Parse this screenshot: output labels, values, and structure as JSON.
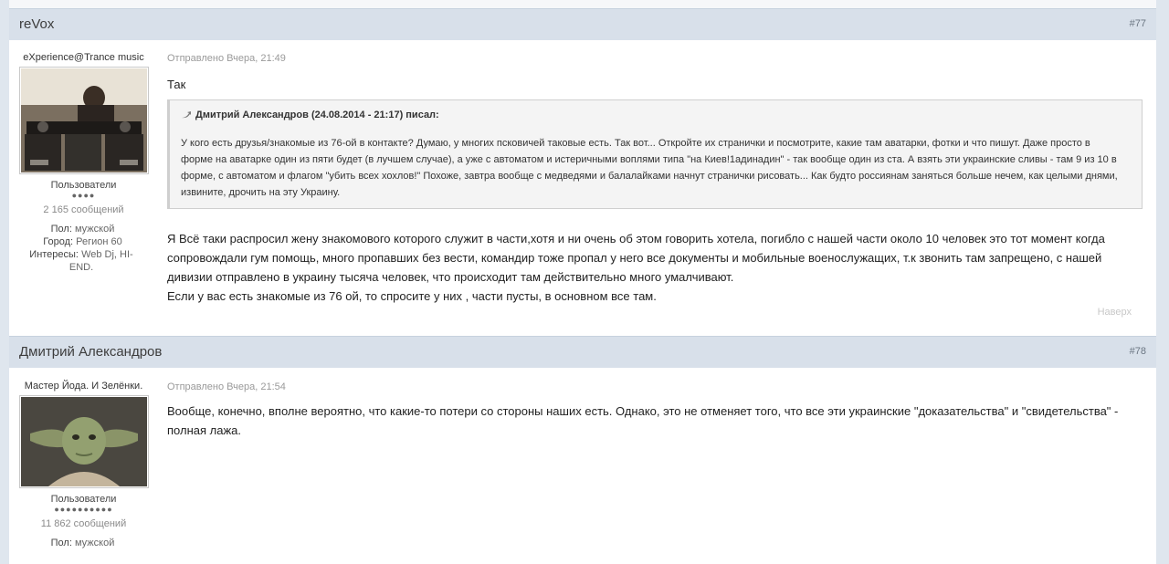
{
  "posts": [
    {
      "author": "reVox",
      "number": "#77",
      "author_title": "eXperience@Trance music",
      "group": "Пользователи",
      "pips": "●●●●",
      "post_count": "2 165 сообщений",
      "info": {
        "gender_label": "Пол:",
        "gender": "мужской",
        "city_label": "Город:",
        "city": "Регион 60",
        "interests_label": "Интересы:",
        "interests": "Web Dj, HI-END."
      },
      "posted": "Отправлено Вчера, 21:49",
      "intro": "Так",
      "quote_author": "Дмитрий Александров (24.08.2014 - 21:17) писал:",
      "quote_lines": [
        "У кого есть друзья/знакомые из 76-ой в контакте? Думаю, у многих псковичей таковые есть. Так вот... Откройте их странички и посмотрите, какие там аватарки, фотки и что пишут. Даже просто в",
        "форме на аватарке один из пяти будет (в лучшем случае), а уже с автоматом и истеричными воплями типа \"на Киев!1адинадин\" - так вообще один из ста. А взять эти украинские сливы - там 9 из 10 в",
        "форме, с автоматом и флагом \"убить всех хохлов!\" Похоже, завтра вообще с медведями и балалайками начнут странички рисовать... Как будто россиянам заняться больше нечем, как целыми днями,",
        "извините, дрочить на эту Украину."
      ],
      "body_lines": [
        "Я Всё таки распросил жену знакомового которого служит в части,хотя и ни очень об этом говорить хотела, погибло с нашей части около 10 человек это тот момент когда",
        "сопровождали гум помощь, много пропавших без вести, командир тоже пропал у него все документы и мобильные военослужащих, т.к звонить там запрещено, с нашей",
        "дивизии отправлено в украину тысяча человек, что происходит там действительно много умалчивают.",
        "Если у вас есть знакомые из 76 ой, то спросите у них , части пусты, в основном все там."
      ],
      "to_top": "Наверх"
    },
    {
      "author": "Дмитрий Александров",
      "number": "#78",
      "author_title": "Мастер Йода. И Зелёнки.",
      "group": "Пользователи",
      "pips": "●●●●●●●●●●",
      "post_count": "11 862 сообщений",
      "info": {
        "gender_label": "Пол:",
        "gender": "мужской"
      },
      "posted": "Отправлено Вчера, 21:54",
      "body_lines": [
        "Вообще, конечно, вполне вероятно, что какие-то потери со стороны наших есть. Однако, это не отменяет того, что все эти украинские \"доказательства\" и \"свидетельства\" -",
        "полная лажа."
      ]
    }
  ],
  "icons": {
    "quote": "quote-arrow-icon"
  }
}
